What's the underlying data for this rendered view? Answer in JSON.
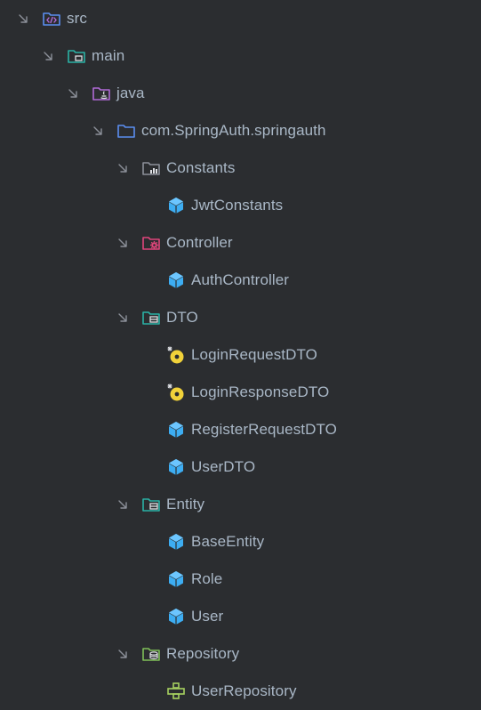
{
  "tree": {
    "src": "src",
    "main": "main",
    "java": "java",
    "package": "com.SpringAuth.springauth",
    "constants": "Constants",
    "jwt_constants": "JwtConstants",
    "controller": "Controller",
    "auth_controller": "AuthController",
    "dto": "DTO",
    "login_request_dto": "LoginRequestDTO",
    "login_response_dto": "LoginResponseDTO",
    "register_request_dto": "RegisterRequestDTO",
    "user_dto": "UserDTO",
    "entity": "Entity",
    "base_entity": "BaseEntity",
    "role": "Role",
    "user": "User",
    "repository": "Repository",
    "user_repository": "UserRepository"
  },
  "icons": {
    "src": "source-folder-icon",
    "main": "module-folder-icon",
    "java": "java-folder-icon",
    "package": "package-folder-icon",
    "constants": "constants-folder-icon",
    "controller": "controller-folder-icon",
    "dto": "dto-folder-icon",
    "entity": "entity-folder-icon",
    "repository": "repository-folder-icon",
    "class": "class-icon",
    "record": "record-icon",
    "interface": "interface-icon"
  },
  "colors": {
    "background": "#2b2d30",
    "text": "#a9b7c6",
    "class_blue": "#3dadf2",
    "record_yellow": "#f1d23a",
    "folder_blue": "#5b8ef0",
    "folder_teal": "#2bb2a5",
    "folder_purple": "#b06ad6",
    "folder_pink": "#e0457b",
    "folder_gray": "#8c9099",
    "folder_green": "#7fbf58",
    "interface_green": "#a6d05f"
  }
}
